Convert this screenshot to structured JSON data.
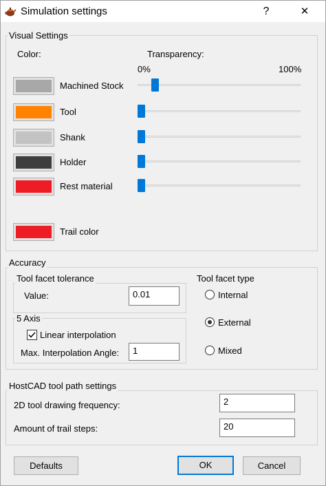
{
  "window": {
    "title": "Simulation settings",
    "help_label": "?",
    "close_label": "✕",
    "app_icon": "teapot-icon"
  },
  "visual_settings": {
    "legend": "Visual Settings",
    "color_header": "Color:",
    "transparency_header": "Transparency:",
    "min_label": "0%",
    "max_label": "100%",
    "items": [
      {
        "label": "Machined Stock",
        "color": "#a8a8a8",
        "transparency_fraction": 0.09
      },
      {
        "label": "Tool",
        "color": "#ff8200",
        "transparency_fraction": 0.0
      },
      {
        "label": "Shank",
        "color": "#c3c3c3",
        "transparency_fraction": 0.0
      },
      {
        "label": "Holder",
        "color": "#3e3e3e",
        "transparency_fraction": 0.0
      },
      {
        "label": "Rest material",
        "color": "#ee1c24",
        "transparency_fraction": 0.0
      }
    ],
    "trail": {
      "label": "Trail color",
      "color": "#ee1c24"
    }
  },
  "accuracy": {
    "legend": "Accuracy",
    "tolerance": {
      "legend": "Tool facet tolerance",
      "value_label": "Value:",
      "value": "0.01"
    },
    "five_axis": {
      "legend": "5 Axis",
      "linear_label": "Linear interpolation",
      "linear_checked": true,
      "angle_label": "Max. Interpolation Angle:",
      "angle_value": "1"
    },
    "facet_type": {
      "legend": "Tool facet type",
      "options": [
        {
          "label": "Internal",
          "selected": false
        },
        {
          "label": "External",
          "selected": true
        },
        {
          "label": "Mixed",
          "selected": false
        }
      ]
    }
  },
  "hostcad": {
    "legend": "HostCAD tool path settings",
    "freq_label": "2D tool drawing frequency:",
    "freq_value": "2",
    "trail_label": "Amount of trail steps:",
    "trail_value": "20"
  },
  "buttons": {
    "defaults": "Defaults",
    "ok": "OK",
    "cancel": "Cancel"
  }
}
